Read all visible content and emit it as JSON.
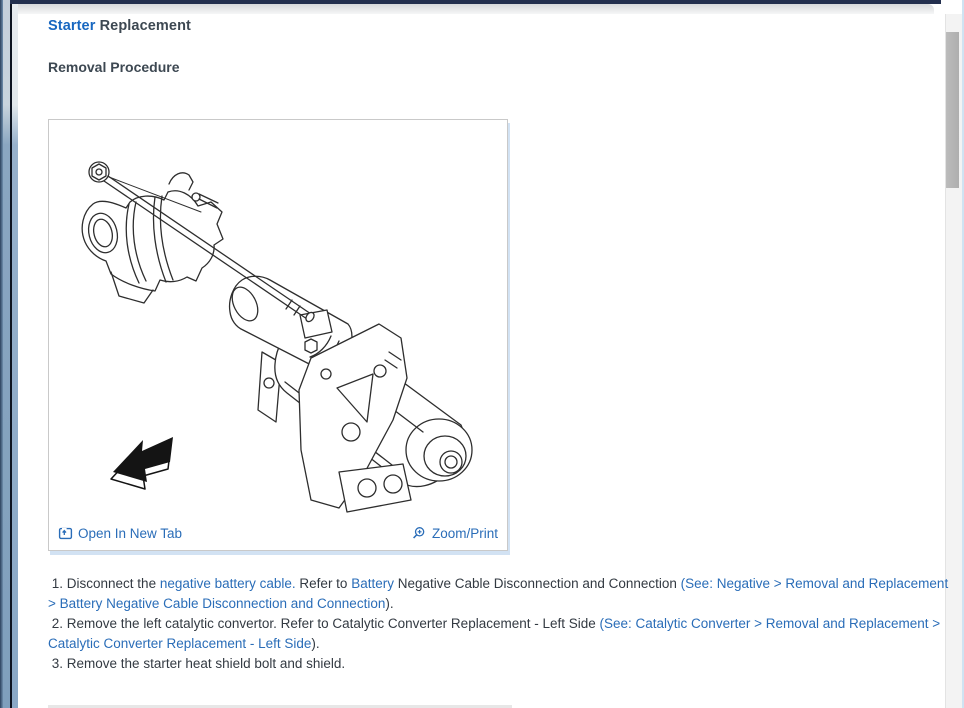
{
  "page": {
    "title": {
      "primary": "Starter",
      "secondary": "Replacement"
    },
    "section_heading": "Removal Procedure"
  },
  "figure": {
    "open_link": "Open In New Tab",
    "zoom_link": "Zoom/Print"
  },
  "steps": [
    {
      "segments": [
        {
          "text": " 1. Disconnect the ",
          "link": false
        },
        {
          "text": "negative battery cable.",
          "link": true
        },
        {
          "text": " Refer to ",
          "link": false
        },
        {
          "text": "Battery",
          "link": true
        },
        {
          "text": " Negative Cable Disconnection and Connection ",
          "link": false
        },
        {
          "text": "(See: Negative > Removal and Replacement > Battery Negative Cable Disconnection and Connection",
          "link": true
        },
        {
          "text": ").",
          "link": false
        }
      ]
    },
    {
      "segments": [
        {
          "text": " 2. Remove the left catalytic convertor. Refer to Catalytic Converter Replacement - Left Side ",
          "link": false
        },
        {
          "text": "(See: Catalytic Converter > Removal and Replacement > Catalytic Converter Replacement - Left Side",
          "link": true
        },
        {
          "text": ").",
          "link": false
        }
      ]
    },
    {
      "segments": [
        {
          "text": " 3. Remove the starter heat shield bolt and shield.",
          "link": false
        }
      ]
    }
  ],
  "colors": {
    "link_blue": "#2a6db8",
    "title_blue": "#1867c0",
    "heading_dark": "#3d4852",
    "body_text": "#333a42",
    "top_bar_navy": "#232f4e",
    "box_border": "#c9c9c9",
    "box_shadow_blue": "#d2e2f3"
  }
}
